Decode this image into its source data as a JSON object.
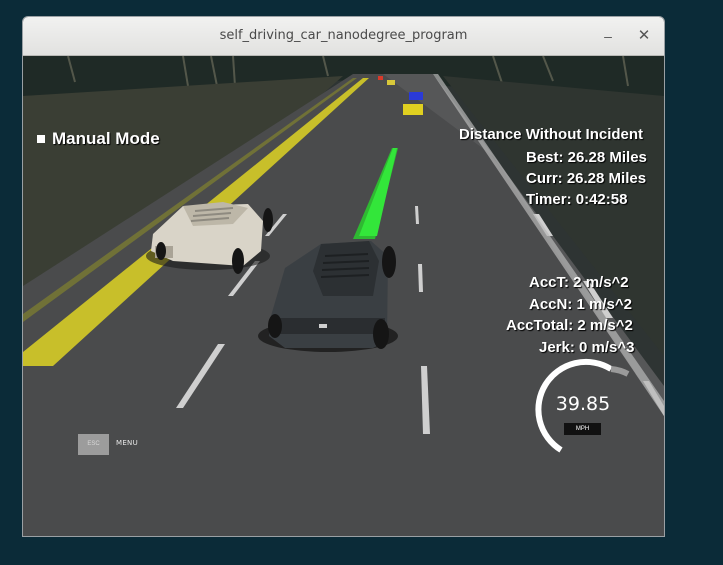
{
  "window": {
    "title": "self_driving_car_nanodegree_program",
    "minimize_glyph": "–",
    "close_glyph": "✕"
  },
  "hud": {
    "mode": "Manual Mode",
    "distance_title": "Distance Without Incident",
    "best": "Best: 26.28 Miles",
    "curr": "Curr: 26.28 Miles",
    "timer": "Timer: 0:42:58",
    "acc_t": "AccT: 2 m/s^2",
    "acc_n": "AccN: 1 m/s^2",
    "acc_total": "AccTotal: 2 m/s^2",
    "jerk": "Jerk: 0 m/s^3"
  },
  "speedometer": {
    "value": "39.85",
    "unit": "MPH",
    "gauge_fraction": 0.45
  },
  "controls": {
    "esc_label": "ESC",
    "menu_label": "MENU"
  },
  "colors": {
    "trajectory": "#33e63a",
    "ego_car": "#3a3f43",
    "other_car": "#d9d4c8",
    "lane_yellow": "#c8bf2a"
  }
}
